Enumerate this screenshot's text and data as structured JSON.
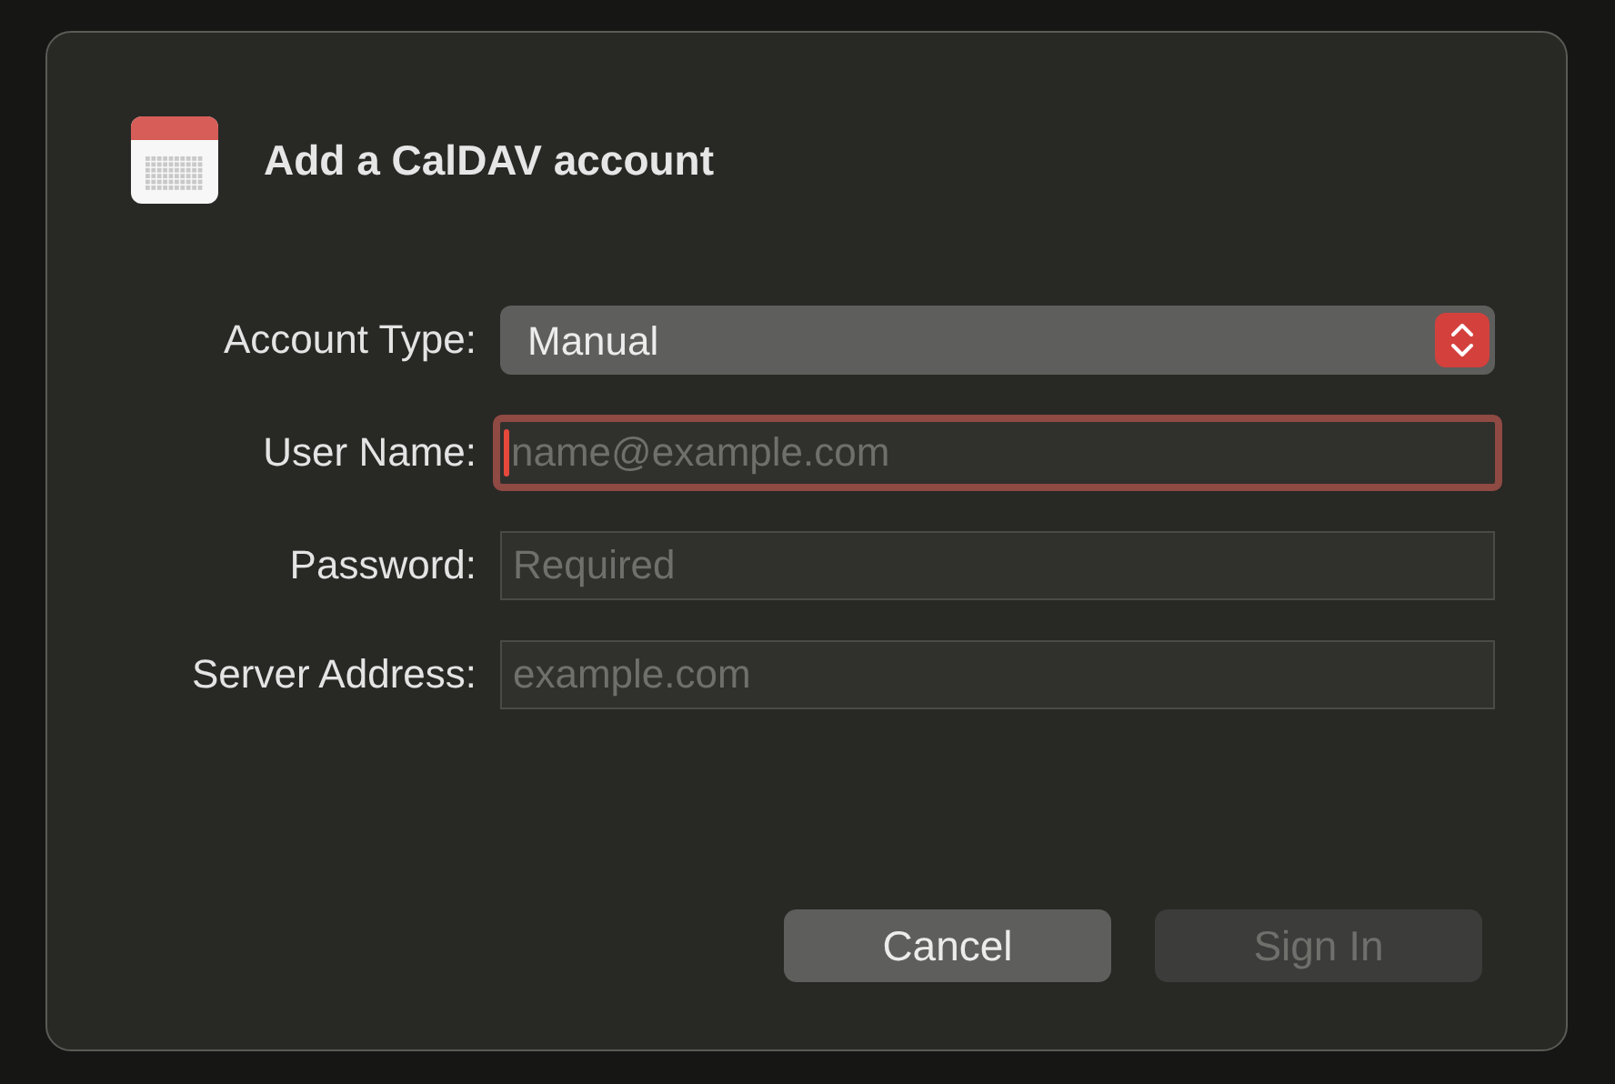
{
  "dialog": {
    "title": "Add a CalDAV account",
    "account_type": {
      "label": "Account Type:",
      "value": "Manual"
    },
    "fields": [
      {
        "label": "User Name:",
        "placeholder": "name@example.com",
        "focused": true
      },
      {
        "label": "Password:",
        "placeholder": "Required",
        "focused": false
      },
      {
        "label": "Server Address:",
        "placeholder": "example.com",
        "focused": false
      }
    ],
    "buttons": [
      {
        "label": "Cancel",
        "disabled": false
      },
      {
        "label": "Sign In",
        "disabled": true
      }
    ]
  }
}
